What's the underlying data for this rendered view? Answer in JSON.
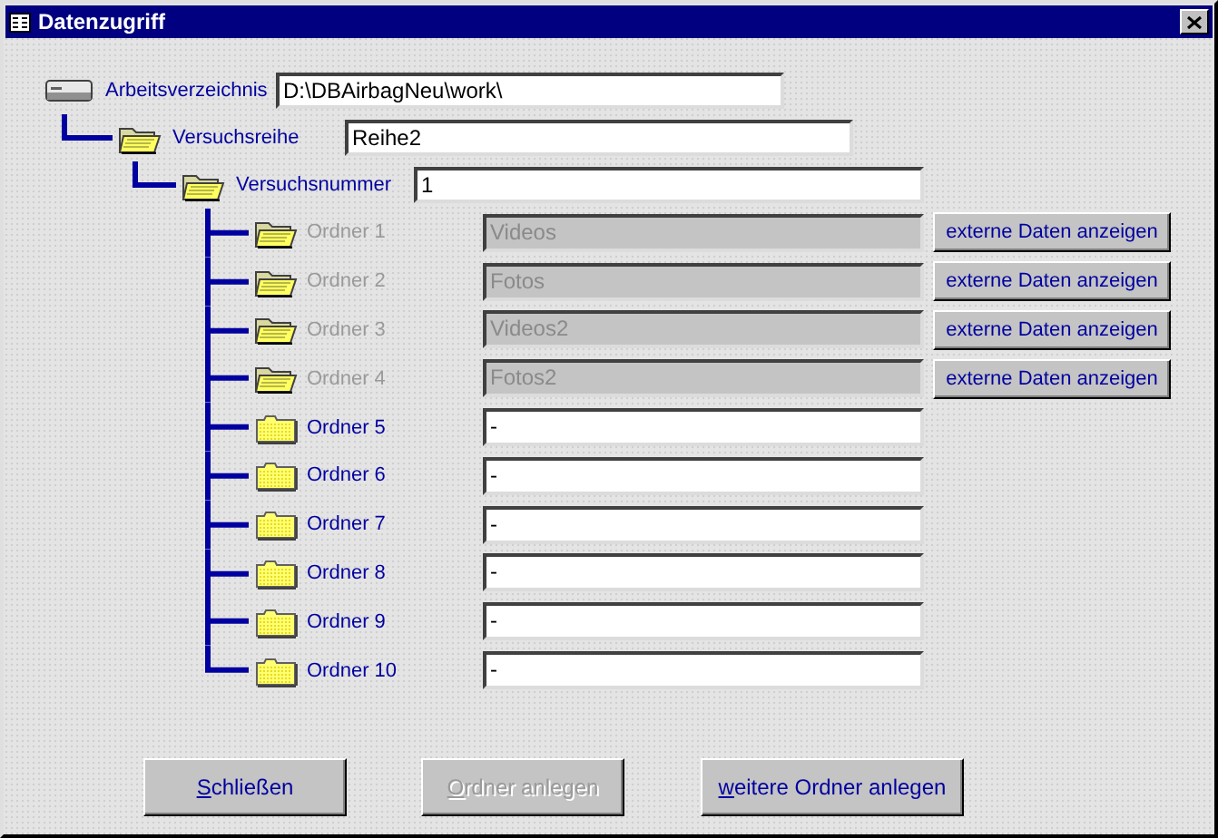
{
  "window": {
    "title": "Datenzugriff"
  },
  "working_directory": {
    "label": "Arbeitsverzeichnis",
    "value": "D:\\DBAirbagNeu\\work\\"
  },
  "series": {
    "label": "Versuchsreihe",
    "value": "Reihe2"
  },
  "test_number": {
    "label": "Versuchsnummer",
    "value": "1"
  },
  "folders": [
    {
      "label": "Ordner 1",
      "value": "Videos",
      "disabled": true,
      "kind": "open",
      "button": "externe Daten anzeigen"
    },
    {
      "label": "Ordner 2",
      "value": "Fotos",
      "disabled": true,
      "kind": "open",
      "button": "externe Daten anzeigen"
    },
    {
      "label": "Ordner 3",
      "value": "Videos2",
      "disabled": true,
      "kind": "open",
      "button": "externe Daten anzeigen"
    },
    {
      "label": "Ordner 4",
      "value": "Fotos2",
      "disabled": true,
      "kind": "open",
      "button": "externe Daten anzeigen"
    },
    {
      "label": "Ordner 5",
      "value": "-",
      "disabled": false,
      "kind": "closed"
    },
    {
      "label": "Ordner 6",
      "value": "-",
      "disabled": false,
      "kind": "closed"
    },
    {
      "label": "Ordner 7",
      "value": "-",
      "disabled": false,
      "kind": "closed"
    },
    {
      "label": "Ordner 8",
      "value": "-",
      "disabled": false,
      "kind": "closed"
    },
    {
      "label": "Ordner 9",
      "value": "-",
      "disabled": false,
      "kind": "closed"
    },
    {
      "label": "Ordner 10",
      "value": "-",
      "disabled": false,
      "kind": "closed"
    }
  ],
  "buttons": [
    {
      "label": "Schließen",
      "disabled": false,
      "underline_first": true
    },
    {
      "label": "Ordner anlegen",
      "disabled": true,
      "underline_first": true
    },
    {
      "label": "weitere Ordner anlegen",
      "disabled": false,
      "underline_first": true
    }
  ]
}
